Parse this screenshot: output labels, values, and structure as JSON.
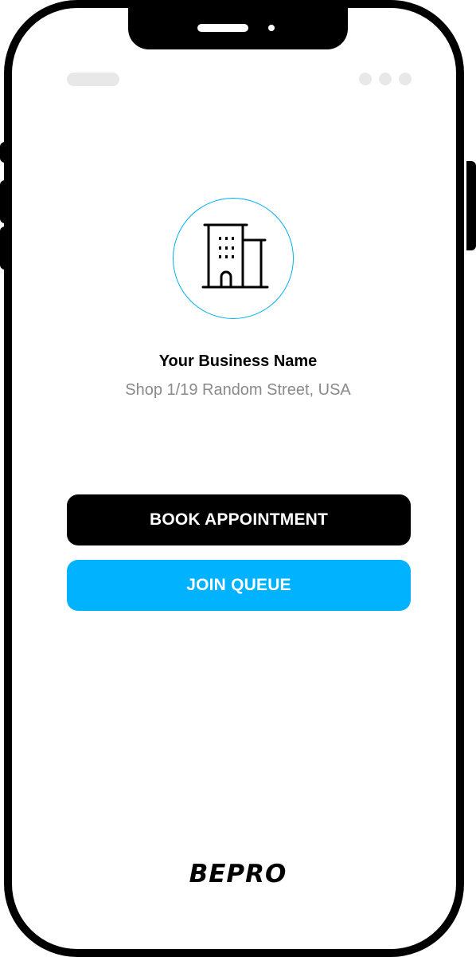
{
  "business": {
    "name": "Your Business Name",
    "address": "Shop 1/19 Random Street, USA",
    "icon": "building-icon"
  },
  "actions": {
    "book_label": "BOOK APPOINTMENT",
    "queue_label": "JOIN QUEUE"
  },
  "brand": {
    "logo_text": "BEPRO"
  },
  "colors": {
    "accent": "#00b2ff",
    "primary": "#000000",
    "address_text": "#8a8a8a",
    "status_placeholder": "#e8e8e8"
  }
}
